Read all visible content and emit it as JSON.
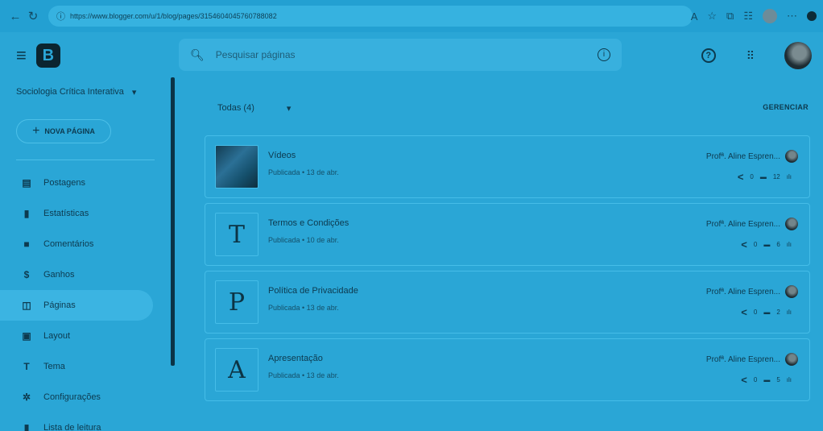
{
  "browser": {
    "url": "https://www.blogger.com/u/1/blog/pages/3154604045760788082"
  },
  "header": {
    "search_placeholder": "Pesquisar páginas",
    "logo": "B"
  },
  "sidebar": {
    "blog_name": "Sociologia Crítica Interativa",
    "new_page_label": "NOVA PÁGINA",
    "items": [
      {
        "icon": "posts-icon",
        "label": "Postagens"
      },
      {
        "icon": "stats-icon",
        "label": "Estatísticas"
      },
      {
        "icon": "comments-icon",
        "label": "Comentários"
      },
      {
        "icon": "earnings-icon",
        "label": "Ganhos"
      },
      {
        "icon": "pages-icon",
        "label": "Páginas"
      },
      {
        "icon": "layout-icon",
        "label": "Layout"
      },
      {
        "icon": "theme-icon",
        "label": "Tema"
      },
      {
        "icon": "settings-icon",
        "label": "Configurações"
      },
      {
        "icon": "reading-list-icon",
        "label": "Lista de leitura"
      }
    ],
    "active_index": 4
  },
  "main": {
    "filter_label": "Todas (4)",
    "manage_label": "GERENCIAR",
    "pages": [
      {
        "thumb": "",
        "title": "Vídeos",
        "status": "Publicada • 13 de abr.",
        "author": "Profª. Aline Espren...",
        "comments": "0",
        "views": "12"
      },
      {
        "thumb": "T",
        "title": "Termos e Condições",
        "status": "Publicada • 10 de abr.",
        "author": "Profª. Aline Espren...",
        "comments": "0",
        "views": "6"
      },
      {
        "thumb": "P",
        "title": "Política de Privacidade",
        "status": "Publicada • 13 de abr.",
        "author": "Profª. Aline Espren...",
        "comments": "0",
        "views": "2"
      },
      {
        "thumb": "A",
        "title": "Apresentação",
        "status": "Publicada • 13 de abr.",
        "author": "Profª. Aline Espren...",
        "comments": "0",
        "views": "5"
      }
    ]
  }
}
